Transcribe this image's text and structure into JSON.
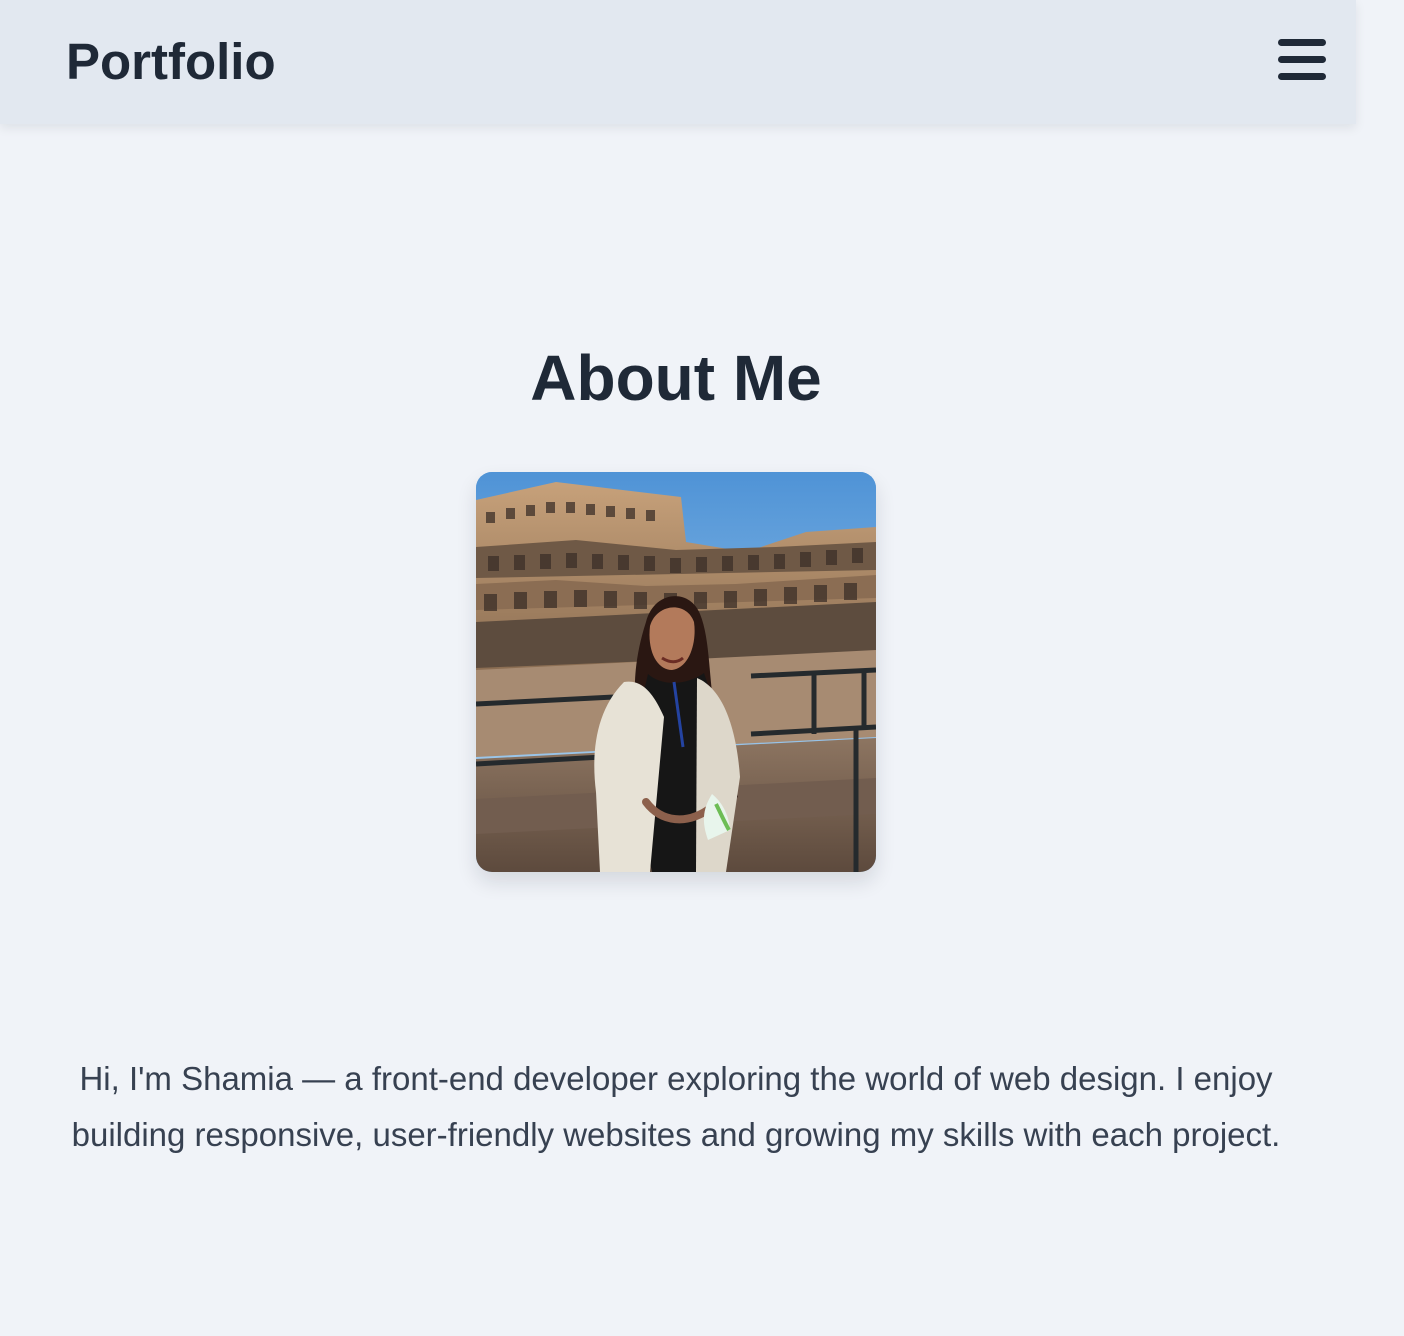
{
  "header": {
    "title": "Portfolio",
    "menu_icon": "hamburger-menu-icon"
  },
  "about": {
    "heading": "About Me",
    "intro": "Hi, I'm Shamia — a front-end developer exploring the world of web design. I enjoy building responsive, user-friendly websites and growing my skills with each project."
  },
  "colors": {
    "page_background": "#f0f3f8",
    "header_background": "#e2e8f0",
    "heading_text": "#1f2937",
    "body_text": "#374151"
  }
}
